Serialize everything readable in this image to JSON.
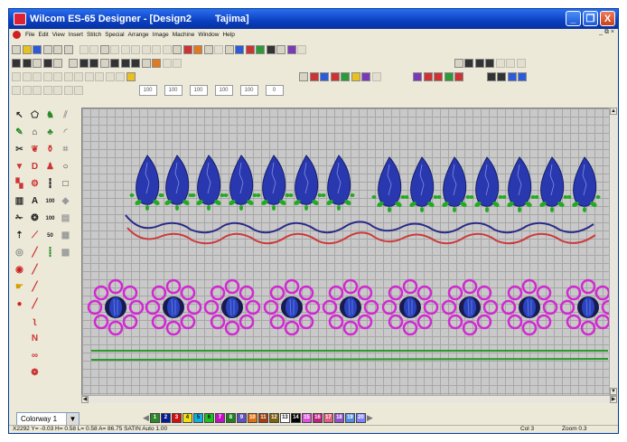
{
  "window": {
    "title": "Wilcom ES-65 Designer - [Design2",
    "title_suffix": "Tajima]",
    "buttons": [
      "_",
      "❐",
      "X"
    ]
  },
  "menu": [
    "File",
    "Edit",
    "View",
    "Insert",
    "Stitch",
    "Special",
    "Arrange",
    "Image",
    "Machine",
    "Window",
    "Help"
  ],
  "mdi_controls": "_ ⧉ ×",
  "toolbar": {
    "zoom_values": [
      "100",
      "100",
      "100",
      "100",
      "100",
      "0"
    ]
  },
  "tools_text": {
    "a_tool": "A",
    "n1": "100",
    "n2": "100",
    "n3": "50"
  },
  "colorway": {
    "label": "Colorway 1",
    "arrow": "▼"
  },
  "palette": {
    "left_arrow": "◀",
    "right_arrow": "▶",
    "swatches": [
      {
        "n": "1",
        "color": "#2a8a2a"
      },
      {
        "n": "2",
        "color": "#0a1a90"
      },
      {
        "n": "3",
        "color": "#d01010"
      },
      {
        "n": "4",
        "color": "#f0e010"
      },
      {
        "n": "5",
        "color": "#10b0e0"
      },
      {
        "n": "6",
        "color": "#20c020"
      },
      {
        "n": "7",
        "color": "#c010c0"
      },
      {
        "n": "8",
        "color": "#208020"
      },
      {
        "n": "9",
        "color": "#6050c0"
      },
      {
        "n": "10",
        "color": "#e07010"
      },
      {
        "n": "11",
        "color": "#a04010"
      },
      {
        "n": "12",
        "color": "#806010"
      },
      {
        "n": "13",
        "color": "#ffffff"
      },
      {
        "n": "14",
        "color": "#000000"
      },
      {
        "n": "15",
        "color": "#e050e0"
      },
      {
        "n": "16",
        "color": "#c02080"
      },
      {
        "n": "17",
        "color": "#e06080"
      },
      {
        "n": "18",
        "color": "#9050d0"
      },
      {
        "n": "19",
        "color": "#5090e0"
      },
      {
        "n": "20",
        "color": "#8080ff"
      }
    ]
  },
  "status": {
    "left": "X2292 Y= -0.03 H= 0.58 L= 0.58 A= 86.75 SATIN Auto 1.00",
    "col": "Col 3",
    "zoom": "Zoom 0.3"
  },
  "colors": {
    "leaf_blue": "#2233aa",
    "leaf_green": "#22aa22",
    "petal_magenta": "#d02ad0",
    "scallop_red": "#cc3a3a",
    "scallop_blue": "#2a2a88",
    "line_green": "#2a9a2a"
  }
}
